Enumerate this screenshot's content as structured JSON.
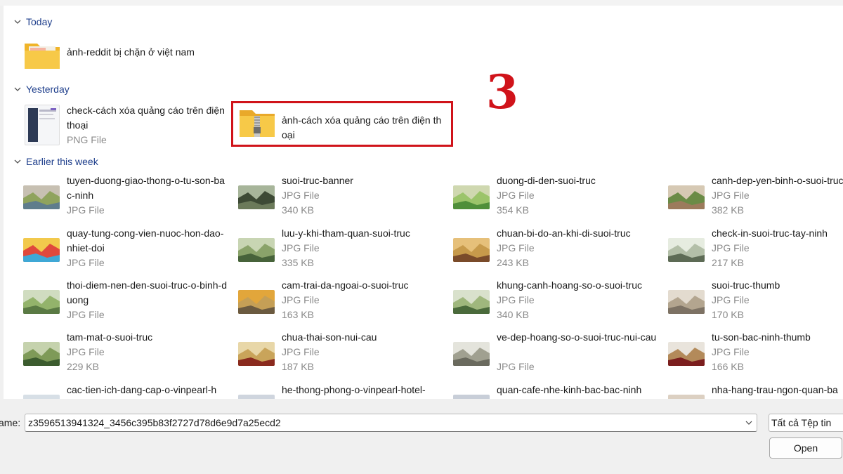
{
  "groups": {
    "today": "Today",
    "yesterday": "Yesterday",
    "earlier": "Earlier this week"
  },
  "today_items": [
    {
      "name": "ảnh-reddit bị chặn ở việt nam",
      "type": "",
      "size": "",
      "icon": "folder-icon"
    }
  ],
  "yesterday_items": [
    {
      "name": "check-cách xóa quảng cáo trên điện thoại",
      "type": "PNG File",
      "size": "",
      "icon": "png-thumbnail"
    },
    {
      "name": "ảnh-cách xóa quảng cáo trên điện thoại",
      "type": "",
      "size": "",
      "icon": "zip-folder-icon"
    }
  ],
  "earlier_items": [
    {
      "name": "tuyen-duong-giao-thong-o-tu-son-bac-ninh",
      "type": "JPG File",
      "size": ""
    },
    {
      "name": "suoi-truc-banner",
      "type": "JPG File",
      "size": "340 KB"
    },
    {
      "name": "duong-di-den-suoi-truc",
      "type": "JPG File",
      "size": "354 KB"
    },
    {
      "name": "canh-dep-yen-binh-o-suoi-truc",
      "type": "JPG File",
      "size": "382 KB"
    },
    {
      "name": "quay-tung-cong-vien-nuoc-hon-dao-nhiet-doi",
      "type": "JPG File",
      "size": ""
    },
    {
      "name": "luu-y-khi-tham-quan-suoi-truc",
      "type": "JPG File",
      "size": "335 KB"
    },
    {
      "name": "chuan-bi-do-an-khi-di-suoi-truc",
      "type": "JPG File",
      "size": "243 KB"
    },
    {
      "name": "check-in-suoi-truc-tay-ninh",
      "type": "JPG File",
      "size": "217 KB"
    },
    {
      "name": "thoi-diem-nen-den-suoi-truc-o-binh-duong",
      "type": "JPG File",
      "size": ""
    },
    {
      "name": "cam-trai-da-ngoai-o-suoi-truc",
      "type": "JPG File",
      "size": "163 KB"
    },
    {
      "name": "khung-canh-hoang-so-o-suoi-truc",
      "type": "JPG File",
      "size": "340 KB"
    },
    {
      "name": "suoi-truc-thumb",
      "type": "JPG File",
      "size": "170 KB"
    },
    {
      "name": "tam-mat-o-suoi-truc",
      "type": "JPG File",
      "size": "229 KB"
    },
    {
      "name": "chua-thai-son-nui-cau",
      "type": "JPG File",
      "size": "187 KB"
    },
    {
      "name": "ve-dep-hoang-so-o-suoi-truc-nui-cau",
      "type": "JPG File",
      "size": ""
    },
    {
      "name": "tu-son-bac-ninh-thumb",
      "type": "JPG File",
      "size": "166 KB"
    },
    {
      "name": "cac-tien-ich-dang-cap-o-vinpearl-h",
      "type": "",
      "size": ""
    },
    {
      "name": "he-thong-phong-o-vinpearl-hotel-",
      "type": "",
      "size": ""
    },
    {
      "name": "quan-cafe-nhe-kinh-bac-bac-ninh",
      "type": "",
      "size": ""
    },
    {
      "name": "nha-hang-trau-ngon-quan-ba",
      "type": "",
      "size": ""
    }
  ],
  "annotation": {
    "step": "3"
  },
  "footer": {
    "filename_label": "ame:",
    "filename_value": "z3596513941324_3456c395b83f2727d78d6e9d7a25ecd2",
    "file_type": "Tất cả Tệp tin",
    "open_label": "Open"
  },
  "colors": {
    "accent_red": "#d0131a",
    "group_header": "#1f3f8c"
  }
}
